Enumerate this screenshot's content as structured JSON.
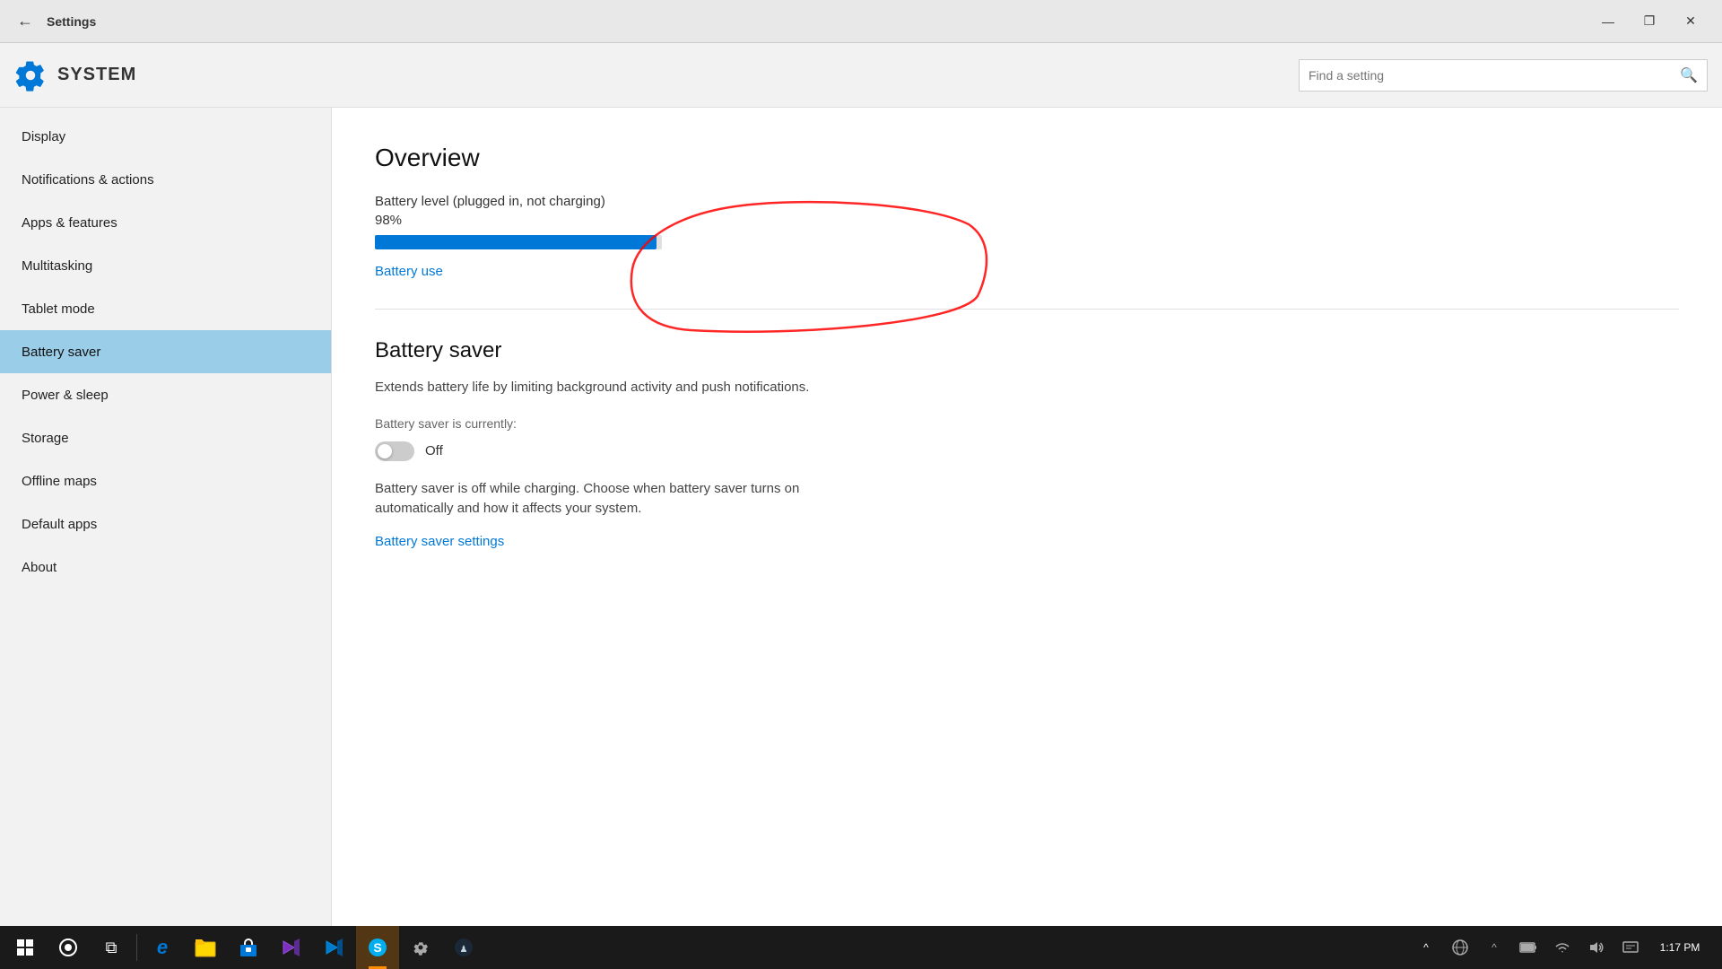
{
  "titleBar": {
    "title": "Settings",
    "backArrow": "←",
    "minimize": "—",
    "restore": "❐",
    "close": "✕"
  },
  "header": {
    "title": "SYSTEM",
    "searchPlaceholder": "Find a setting",
    "searchIcon": "🔍"
  },
  "sidebar": {
    "items": [
      {
        "label": "Display",
        "active": false
      },
      {
        "label": "Notifications & actions",
        "active": false
      },
      {
        "label": "Apps & features",
        "active": false
      },
      {
        "label": "Multitasking",
        "active": false
      },
      {
        "label": "Tablet mode",
        "active": false
      },
      {
        "label": "Battery saver",
        "active": true
      },
      {
        "label": "Power & sleep",
        "active": false
      },
      {
        "label": "Storage",
        "active": false
      },
      {
        "label": "Offline maps",
        "active": false
      },
      {
        "label": "Default apps",
        "active": false
      },
      {
        "label": "About",
        "active": false
      }
    ]
  },
  "content": {
    "overview": {
      "title": "Overview",
      "batteryLabel": "Battery level (plugged in, not charging)",
      "batteryPercent": "98%",
      "batteryFillPercent": 98,
      "batteryUseLink": "Battery use"
    },
    "batterySaver": {
      "title": "Battery saver",
      "description": "Extends battery life by limiting background activity and push notifications.",
      "statusLabel": "Battery saver is currently:",
      "toggleState": "Off",
      "toggleOn": false,
      "note": "Battery saver is off while charging. Choose when battery saver turns on automatically and how it affects your system.",
      "settingsLink": "Battery saver settings"
    }
  },
  "taskbar": {
    "time": "1:17 PM",
    "apps": [
      {
        "icon": "⊞",
        "name": "start",
        "color": "#fff"
      },
      {
        "icon": "◎",
        "name": "cortana",
        "color": "#fff"
      },
      {
        "icon": "⧉",
        "name": "task-view",
        "color": "#fff"
      },
      {
        "icon": "e",
        "name": "edge",
        "color": "#0078d7",
        "active": false
      },
      {
        "icon": "📁",
        "name": "file-explorer",
        "active": false
      },
      {
        "icon": "🛍",
        "name": "store",
        "active": false
      },
      {
        "icon": "VS",
        "name": "visual-studio",
        "active": false
      },
      {
        "icon": "VS",
        "name": "vs-code",
        "active": false
      },
      {
        "icon": "S",
        "name": "skype",
        "active": true,
        "activeColor": "orange"
      },
      {
        "icon": "⚙",
        "name": "settings",
        "active": false
      },
      {
        "icon": "♟",
        "name": "steam",
        "active": false
      }
    ],
    "tray": {
      "show_hidden": "^",
      "globe": "🌐",
      "chevron_up": "⌃",
      "battery": "🔋",
      "wifi": "📶",
      "volume": "🔊",
      "notification": "💬"
    }
  }
}
